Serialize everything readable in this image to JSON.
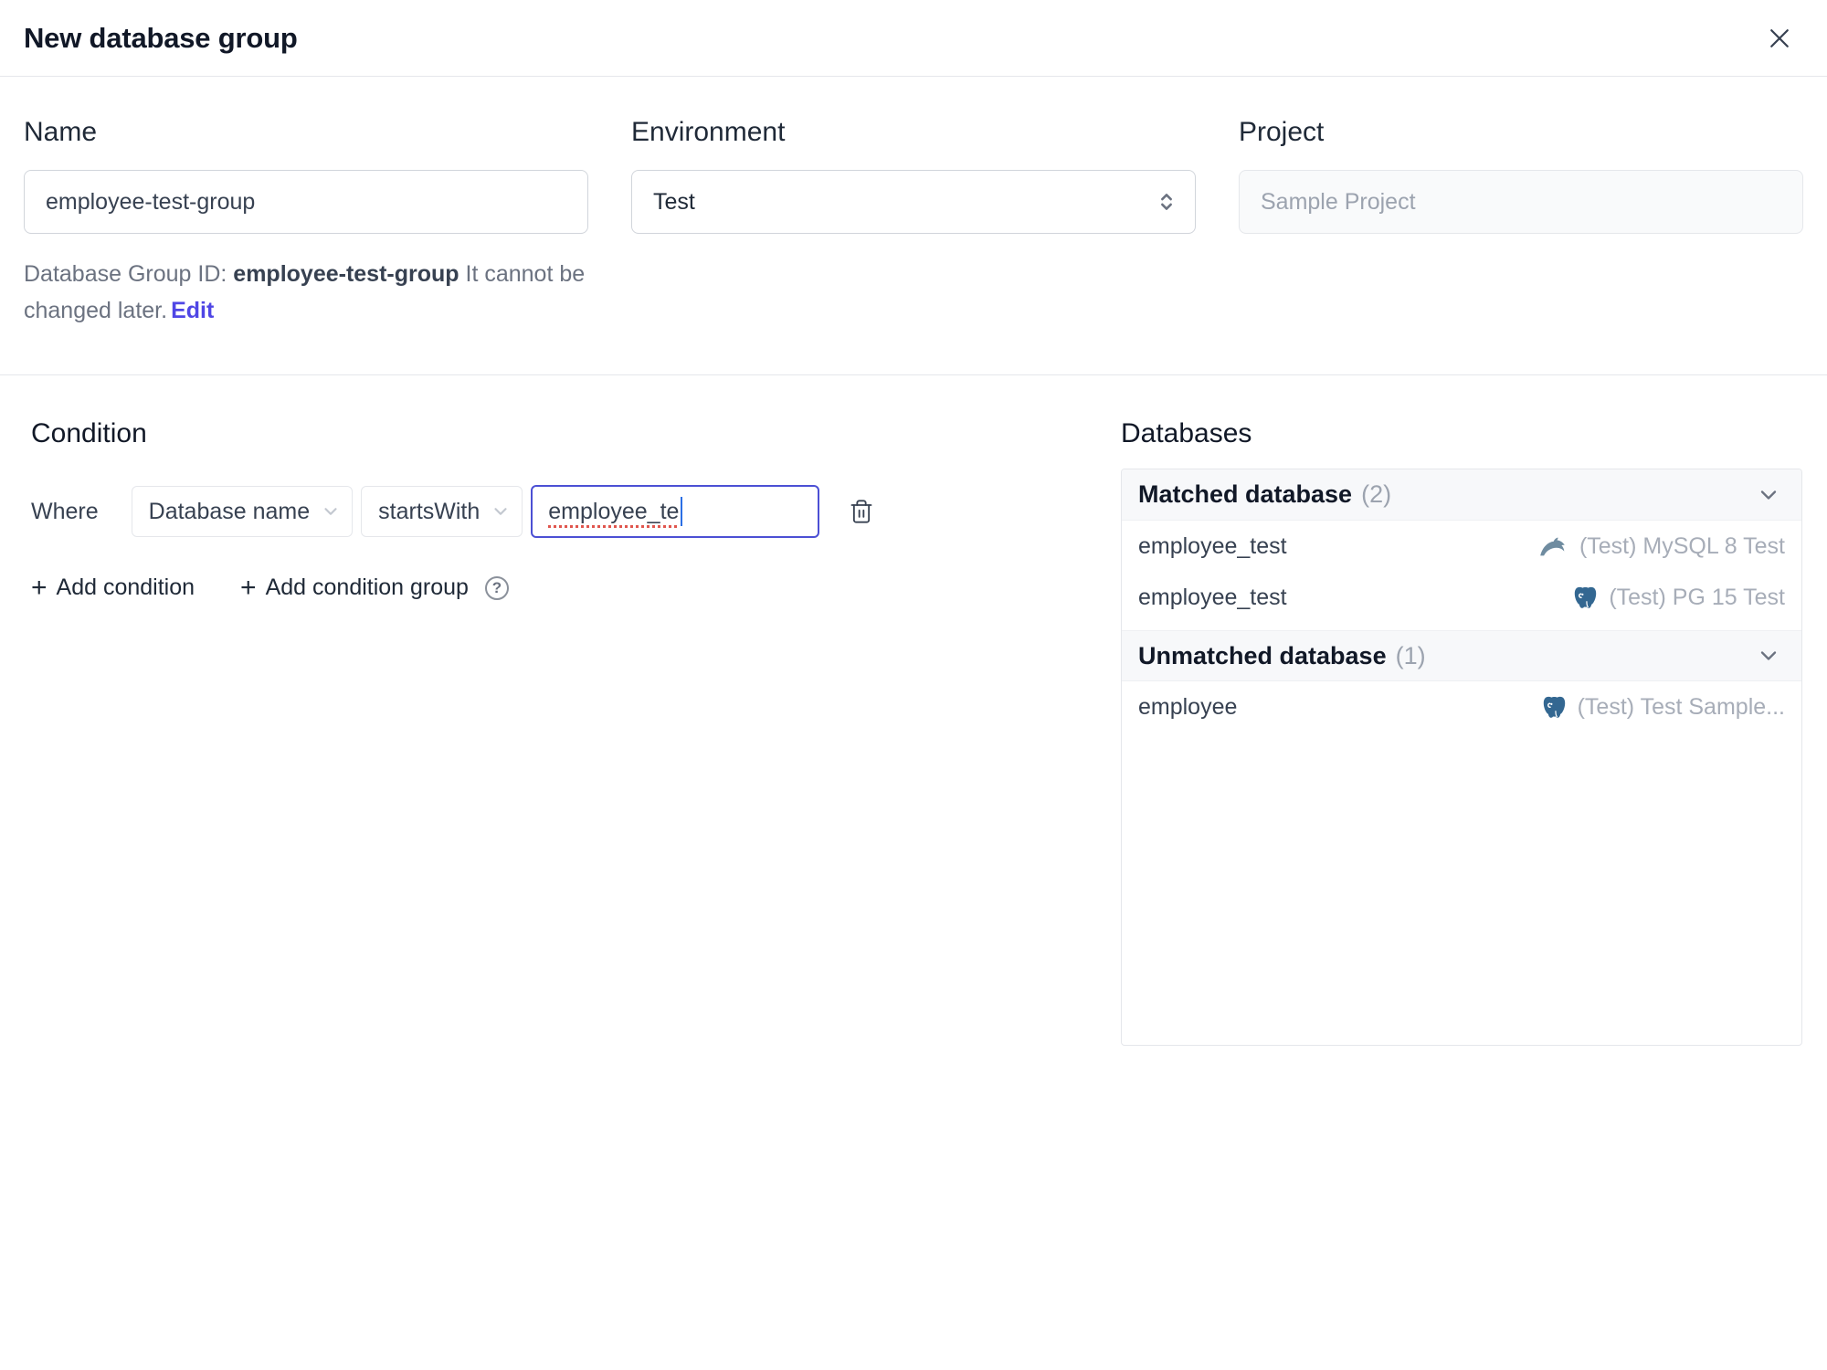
{
  "dialog": {
    "title": "New database group"
  },
  "form": {
    "name": {
      "label": "Name",
      "value": "employee-test-group"
    },
    "environment": {
      "label": "Environment",
      "value": "Test"
    },
    "project": {
      "label": "Project",
      "value": "Sample Project"
    },
    "group_id": {
      "prefix": "Database Group ID: ",
      "id": "employee-test-group",
      "suffix": " It cannot be changed later.",
      "edit_label": "Edit"
    }
  },
  "condition": {
    "heading": "Condition",
    "where_label": "Where",
    "field": "Database name",
    "operator": "startsWith",
    "value": "employee_te",
    "add_condition_label": "Add condition",
    "add_condition_group_label": "Add condition group"
  },
  "databases": {
    "heading": "Databases",
    "groups": [
      {
        "label": "Matched database",
        "count": "(2)",
        "rows": [
          {
            "name": "employee_test",
            "engine": "mysql",
            "instance": "(Test) MySQL 8 Test"
          },
          {
            "name": "employee_test",
            "engine": "postgresql",
            "instance": "(Test) PG 15 Test"
          }
        ]
      },
      {
        "label": "Unmatched database",
        "count": "(1)",
        "rows": [
          {
            "name": "employee",
            "engine": "postgresql",
            "instance": "(Test) Test Sample..."
          }
        ]
      }
    ]
  },
  "icons": {
    "plus": "+",
    "help": "?"
  },
  "colors": {
    "accent": "#4f46e5",
    "focus_border": "#4c50d4",
    "text": "#374151",
    "muted": "#9ca3af",
    "border": "#e5e7eb",
    "panel_header_bg": "#f7f8fa",
    "mysql": "#6f8ca0",
    "postgresql": "#336791",
    "spellcheck": "#e0564e"
  }
}
